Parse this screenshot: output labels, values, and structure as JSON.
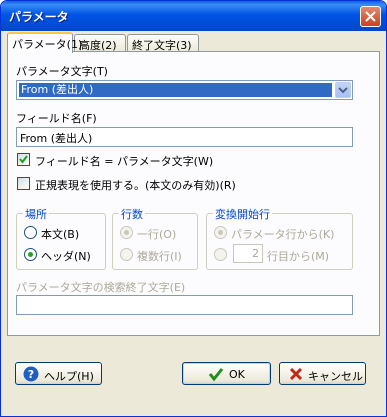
{
  "window": {
    "title": "パラメータ"
  },
  "tabs": [
    {
      "label": "パラメータ(1)",
      "active": true
    },
    {
      "label": "高度(2)",
      "active": false
    },
    {
      "label": "終了文字(3)",
      "active": false
    }
  ],
  "param_text": {
    "label": "パラメータ文字(T)",
    "selected": "From (差出人)"
  },
  "field_name": {
    "label": "フィールド名(F)",
    "value": "From (差出人)"
  },
  "checks": [
    {
      "label": "フィールド名 = パラメータ文字(W)",
      "checked": true
    },
    {
      "label": "正規表現を使用する。(本文のみ有効)(R)",
      "checked": false
    }
  ],
  "location": {
    "title": "場所",
    "options": [
      {
        "label": "本文(B)",
        "selected": false
      },
      {
        "label": "ヘッダ(N)",
        "selected": true
      }
    ]
  },
  "line_count": {
    "title": "行数",
    "options": [
      {
        "label": "一行(O)",
        "selected": true
      },
      {
        "label": "複数行(I)",
        "selected": false
      }
    ]
  },
  "start_line": {
    "title": "変換開始行",
    "options": [
      {
        "label": "パラメータ行から(K)",
        "selected": true
      },
      {
        "label": "行目から(M)",
        "selected": false
      }
    ],
    "line_value": "2"
  },
  "search_end": {
    "label": "パラメータ文字の検索終了文字(E)",
    "value": ""
  },
  "buttons": {
    "help": "ヘルプ(H)",
    "ok": "OK",
    "cancel": "キャンセル"
  },
  "colors": {
    "titlebar": "#0055e5",
    "group_title": "#0046d5",
    "selection": "#316ac5"
  }
}
